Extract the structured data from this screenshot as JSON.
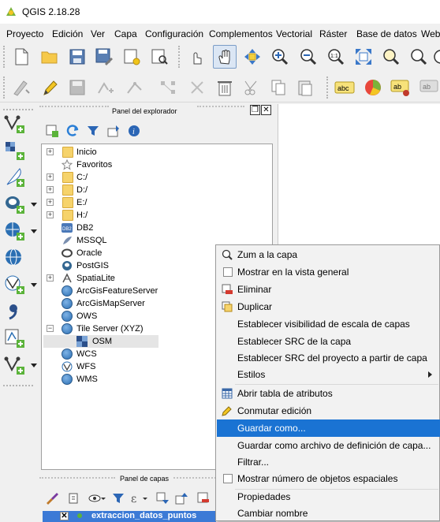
{
  "app": {
    "title": "QGIS 2.18.28"
  },
  "menubar": [
    "Proyecto",
    "Edición",
    "Ver",
    "Capa",
    "Configuración",
    "Complementos",
    "Vectorial",
    "Ráster",
    "Base de datos",
    "Web"
  ],
  "browser_panel": {
    "title": "Panel del explorador",
    "items": [
      {
        "label": "Inicio",
        "icon": "folder-icon",
        "expandable": true
      },
      {
        "label": "Favoritos",
        "icon": "star-icon",
        "expandable": false
      },
      {
        "label": "C:/",
        "icon": "folder-icon",
        "expandable": true
      },
      {
        "label": "D:/",
        "icon": "folder-icon",
        "expandable": true
      },
      {
        "label": "E:/",
        "icon": "folder-icon",
        "expandable": true
      },
      {
        "label": "H:/",
        "icon": "folder-icon",
        "expandable": true
      },
      {
        "label": "DB2",
        "icon": "db2-icon",
        "expandable": false
      },
      {
        "label": "MSSQL",
        "icon": "mssql-icon",
        "expandable": false
      },
      {
        "label": "Oracle",
        "icon": "oracle-icon",
        "expandable": false
      },
      {
        "label": "PostGIS",
        "icon": "postgis-icon",
        "expandable": false
      },
      {
        "label": "SpatiaLite",
        "icon": "spatialite-icon",
        "expandable": true
      },
      {
        "label": "ArcGisFeatureServer",
        "icon": "globe-icon",
        "expandable": false
      },
      {
        "label": "ArcGisMapServer",
        "icon": "globe-icon",
        "expandable": false
      },
      {
        "label": "OWS",
        "icon": "globe-icon",
        "expandable": false
      },
      {
        "label": "Tile Server (XYZ)",
        "icon": "globe-icon",
        "expandable": true,
        "expanded": true
      },
      {
        "label": "OSM",
        "icon": "tile-icon",
        "child": true
      },
      {
        "label": "WCS",
        "icon": "globe-icon",
        "expandable": false
      },
      {
        "label": "WFS",
        "icon": "wfs-icon",
        "expandable": false
      },
      {
        "label": "WMS",
        "icon": "globe-icon",
        "expandable": false
      }
    ]
  },
  "layers_panel": {
    "title": "Panel de capas",
    "layer_name": "extraccion_datos_puntos"
  },
  "context_menu": {
    "items": [
      {
        "label": "Zum a la capa",
        "icon": "zoom-icon"
      },
      {
        "label": "Mostrar en la vista general",
        "icon": "checkbox-icon"
      },
      {
        "label": "Eliminar",
        "icon": "remove-layer-icon"
      },
      {
        "label": "Duplicar",
        "icon": "duplicate-icon"
      },
      {
        "label": "Establecer visibilidad de escala de capas",
        "icon": ""
      },
      {
        "label": "Establecer SRC de la capa",
        "icon": ""
      },
      {
        "label": "Establecer SRC del proyecto a partir de capa",
        "icon": ""
      },
      {
        "label": "Estilos",
        "icon": "",
        "submenu": true
      },
      {
        "label": "Abrir tabla de atributos",
        "icon": "table-icon"
      },
      {
        "label": "Conmutar edición",
        "icon": "pencil-icon"
      },
      {
        "label": "Guardar como...",
        "icon": "",
        "highlighted": true
      },
      {
        "label": "Guardar como archivo de definición de capa...",
        "icon": ""
      },
      {
        "label": "Filtrar...",
        "icon": ""
      },
      {
        "label": "Mostrar número de objetos espaciales",
        "icon": "checkbox-icon"
      },
      {
        "label": "Propiedades",
        "icon": ""
      },
      {
        "label": "Cambiar nombre",
        "icon": ""
      }
    ]
  },
  "colors": {
    "highlight": "#1a73d3",
    "layer_selected": "#3b7ad6"
  }
}
